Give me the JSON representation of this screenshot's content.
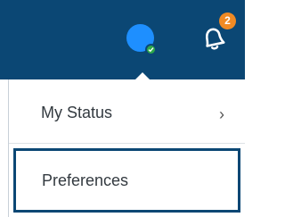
{
  "header": {
    "avatar_icon": "user-avatar",
    "presence": "available",
    "bell_icon": "bell-icon",
    "notification_count": "2",
    "colors": {
      "bar": "#0b4774",
      "avatar": "#1e8fff",
      "presence": "#2ea84a",
      "badge": "#f08a24"
    }
  },
  "menu": {
    "items": [
      {
        "label": "My Status",
        "chevron": "›"
      },
      {
        "label": "Preferences"
      }
    ]
  }
}
